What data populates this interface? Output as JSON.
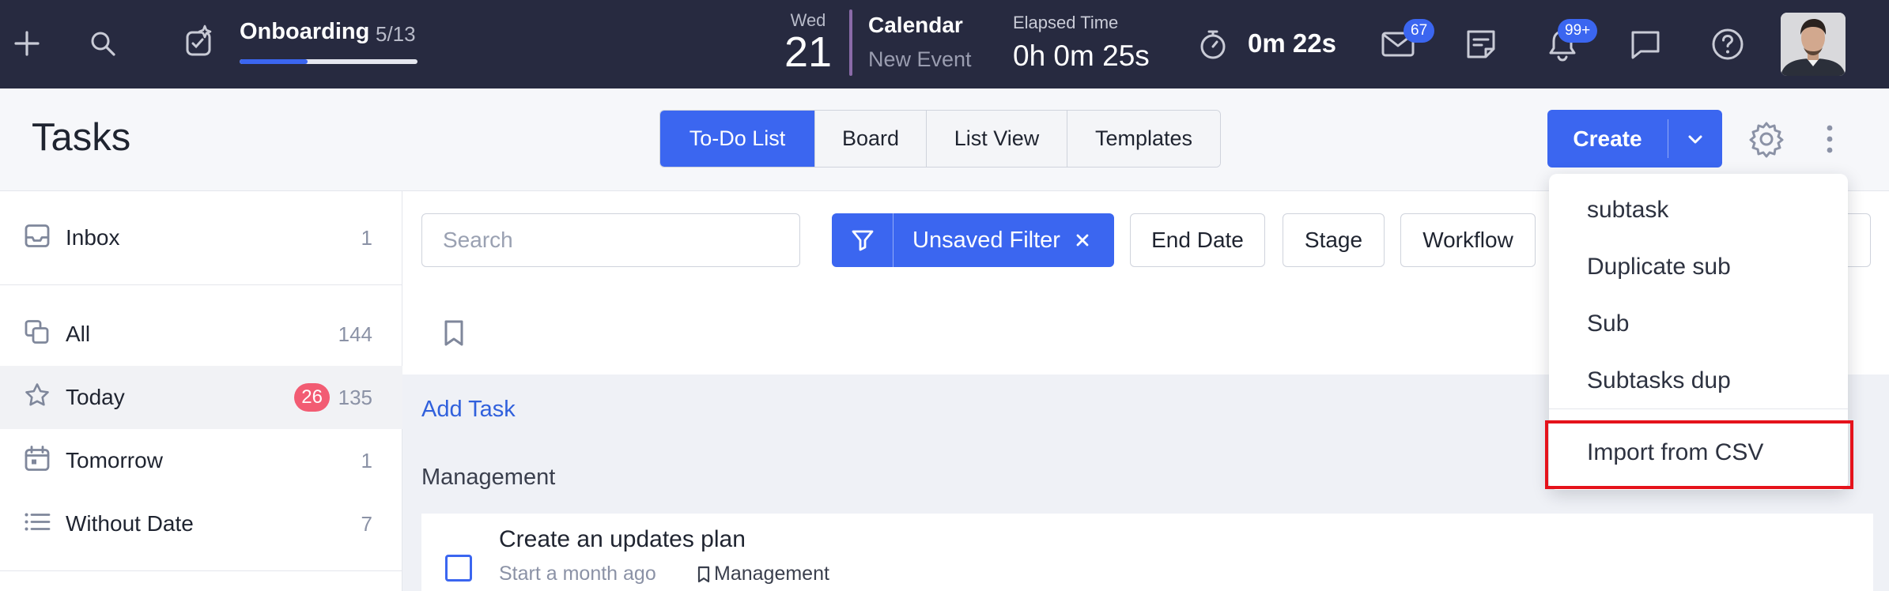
{
  "topbar": {
    "onboarding": {
      "title": "Onboarding",
      "count": "5/13",
      "progress": 0.38
    },
    "calendar": {
      "day_name": "Wed",
      "day_number": "21",
      "title": "Calendar",
      "subtitle": "New Event"
    },
    "elapsed": {
      "label": "Elapsed Time",
      "value": "0h 0m 25s"
    },
    "timer": {
      "value": "0m 22s"
    },
    "mail_badge": "67",
    "notifications_badge": "99+"
  },
  "header": {
    "title": "Tasks",
    "tabs": [
      {
        "label": "To-Do List"
      },
      {
        "label": "Board"
      },
      {
        "label": "List View"
      },
      {
        "label": "Templates"
      }
    ],
    "create_label": "Create"
  },
  "sidebar": {
    "items": [
      {
        "label": "Inbox",
        "count": "1",
        "icon": "inbox-icon"
      },
      {
        "label": "All",
        "count": "144",
        "icon": "copy-icon"
      },
      {
        "label": "Today",
        "count": "135",
        "badge": "26",
        "icon": "star-icon"
      },
      {
        "label": "Tomorrow",
        "count": "1",
        "icon": "calendar-icon"
      },
      {
        "label": "Without Date",
        "count": "7",
        "icon": "list-icon"
      }
    ]
  },
  "toolbar": {
    "search_placeholder": "Search",
    "filter_label": "Unsaved Filter",
    "chips": [
      {
        "label": "End Date"
      },
      {
        "label": "Stage"
      },
      {
        "label": "Workflow"
      }
    ]
  },
  "main": {
    "add_task": "Add Task",
    "group_title": "Management",
    "task": {
      "title": "Create an updates plan",
      "meta": "Start a month ago",
      "tag": "Management"
    }
  },
  "create_menu": {
    "items": [
      {
        "label": "subtask"
      },
      {
        "label": "Duplicate sub"
      },
      {
        "label": "Sub"
      },
      {
        "label": "Subtasks dup"
      }
    ],
    "import_label": "Import from CSV"
  },
  "colors": {
    "topbar_bg": "#272a40",
    "accent": "#3b66f0",
    "badge_red": "#f25c73",
    "highlight": "#e5121b"
  }
}
